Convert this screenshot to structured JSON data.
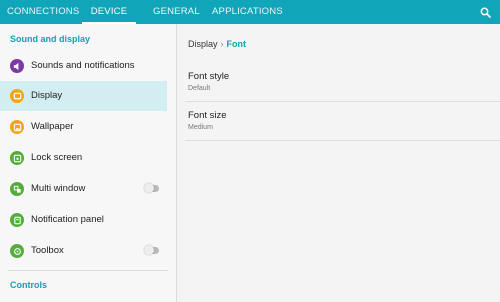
{
  "tabs": [
    {
      "label": "CONNECTIONS"
    },
    {
      "label": "DEVICE"
    },
    {
      "label": "GENERAL"
    },
    {
      "label": "APPLICATIONS"
    }
  ],
  "colors": {
    "accent": "#10a5b8",
    "selected": "#d3eef2"
  },
  "sidebar": {
    "section_title": "Sound and display",
    "items": [
      {
        "label": "Sounds and notifications",
        "icon": "speaker-icon"
      },
      {
        "label": "Display",
        "icon": "display-icon"
      },
      {
        "label": "Wallpaper",
        "icon": "wallpaper-icon"
      },
      {
        "label": "Lock screen",
        "icon": "lock-screen-icon"
      },
      {
        "label": "Multi window",
        "icon": "multi-window-icon",
        "toggle": false
      },
      {
        "label": "Notification panel",
        "icon": "notification-panel-icon"
      },
      {
        "label": "Toolbox",
        "icon": "toolbox-icon",
        "toggle": false
      }
    ],
    "controls_title": "Controls"
  },
  "main": {
    "breadcrumb": {
      "parent": "Display",
      "separator": "›",
      "current": "Font"
    },
    "settings": [
      {
        "title": "Font style",
        "value": "Default"
      },
      {
        "title": "Font size",
        "value": "Medium"
      }
    ]
  }
}
